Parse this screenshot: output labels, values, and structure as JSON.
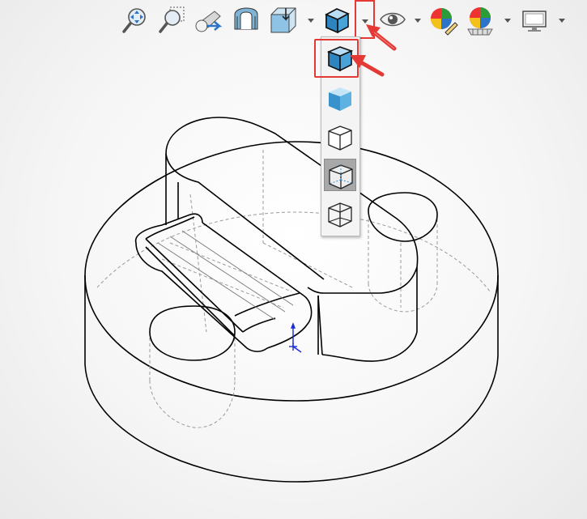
{
  "toolbar": {
    "buttons": [
      {
        "icon": "zoom-to-fit-icon"
      },
      {
        "icon": "zoom-to-area-icon"
      },
      {
        "icon": "previous-view-icon"
      },
      {
        "icon": "section-view-icon"
      },
      {
        "icon": "view-orientation-icon"
      },
      {
        "icon": "display-style-icon"
      },
      {
        "icon": "hide-show-items-icon"
      },
      {
        "icon": "edit-appearance-icon"
      },
      {
        "icon": "apply-scene-icon"
      },
      {
        "icon": "view-settings-icon"
      }
    ]
  },
  "display_style_menu": {
    "items": [
      {
        "icon": "shaded-with-edges-icon",
        "state": "highlighted"
      },
      {
        "icon": "shaded-icon",
        "state": "normal"
      },
      {
        "icon": "hidden-lines-removed-icon",
        "state": "normal"
      },
      {
        "icon": "hidden-lines-visible-icon",
        "state": "selected"
      },
      {
        "icon": "wireframe-icon",
        "state": "normal"
      }
    ]
  },
  "colors": {
    "highlight": "#e53935",
    "icon_blue": "#4aa3d8",
    "selected_bg": "#a8a8a8"
  }
}
